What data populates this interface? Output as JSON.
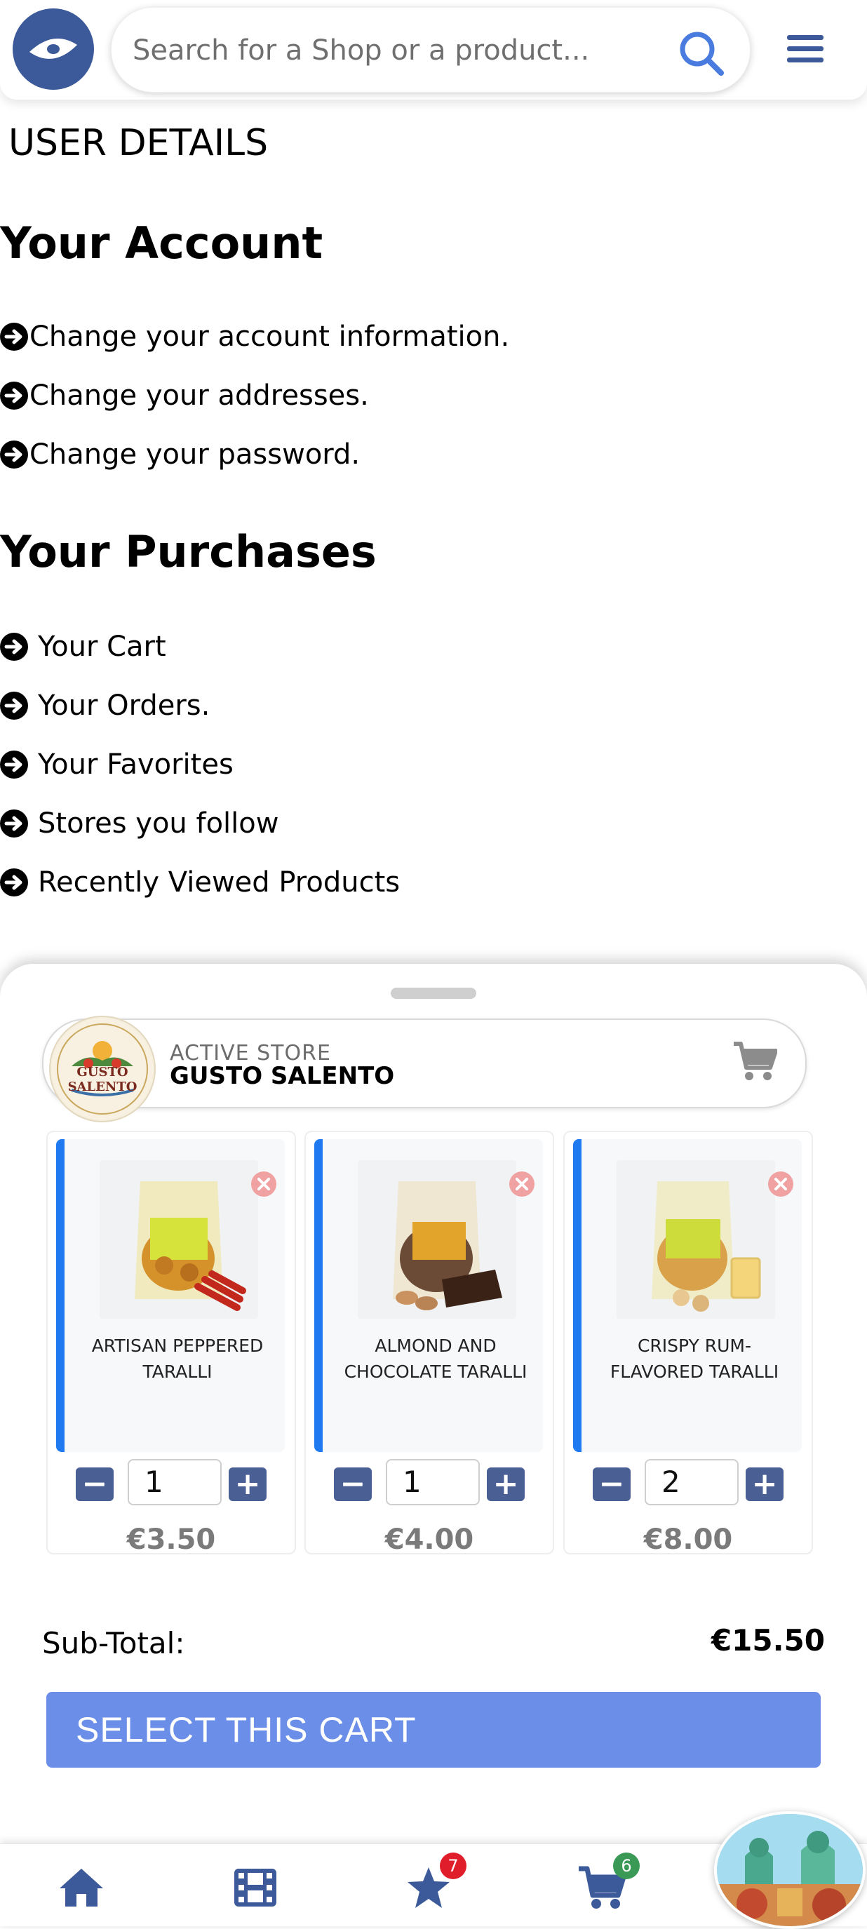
{
  "header": {
    "search_placeholder": "Search for a Shop or a product...",
    "logo_icon": "eye-logo-icon",
    "search_icon": "search-icon",
    "menu_icon": "hamburger-menu-icon"
  },
  "page": {
    "heading": "USER DETAILS",
    "account": {
      "title": "Your Account",
      "links": [
        "Change your account information.",
        "Change your addresses.",
        "Change your password."
      ]
    },
    "purchases": {
      "title": "Your Purchases",
      "links": [
        "Your Cart",
        "Your Orders.",
        "Your Favorites",
        "Stores you follow",
        "Recently Viewed Products"
      ]
    }
  },
  "cart_sheet": {
    "store_kicker": "ACTIVE STORE",
    "store_name": "GUSTO SALENTO",
    "store_logo_text": "GUSTO SALENTO",
    "products": [
      {
        "name": "ARTISAN PEPPERED TARALLI",
        "qty": "1",
        "price": "€3.50"
      },
      {
        "name": "ALMOND AND CHOCOLATE TARALLI",
        "qty": "1",
        "price": "€4.00"
      },
      {
        "name": "CRISPY RUM-FLAVORED TARALLI",
        "qty": "2",
        "price": "€8.00"
      }
    ],
    "subtotal_label": "Sub-Total:",
    "subtotal_value": "€15.50",
    "select_button": "SELECT THIS CART",
    "accent_color": "#1f79f0",
    "button_color": "#6b8fe8"
  },
  "bottom_nav": {
    "items": [
      {
        "icon": "home-icon"
      },
      {
        "icon": "film-icon"
      },
      {
        "icon": "star-icon",
        "badge": "7"
      },
      {
        "icon": "cart-icon",
        "badge": "6"
      }
    ]
  }
}
